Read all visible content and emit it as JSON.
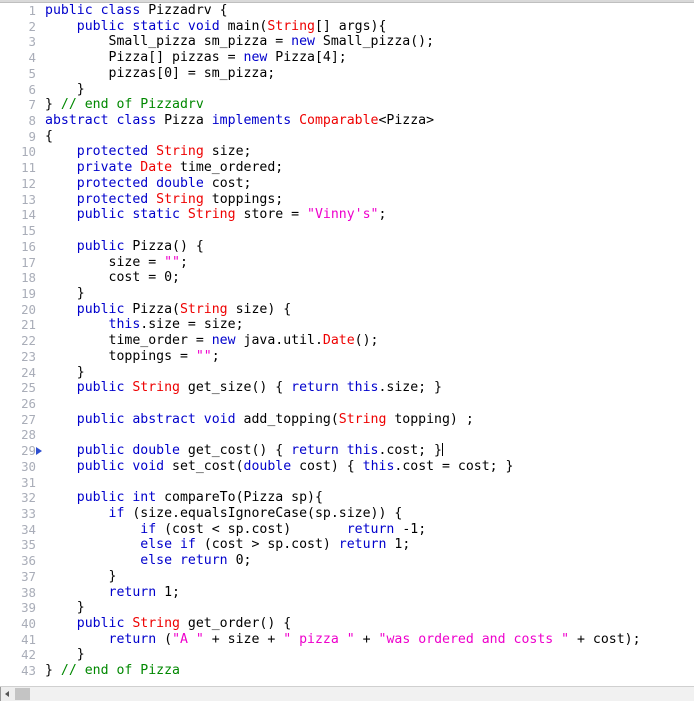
{
  "editor": {
    "language": "java",
    "colors": {
      "keyword": "#0000cc",
      "type": "#ee0000",
      "string": "#ee00cc",
      "comment": "#008800",
      "plain": "#000000",
      "line_number": "#a9adb8",
      "background": "#ffffff",
      "scrollbar_thumb": "#c4c4c4"
    },
    "caret_line": 29,
    "marker_line": 29,
    "first_visible_line": 1,
    "last_visible_line": 43,
    "scrollbar": {
      "orientation": "horizontal",
      "left_arrow_glyph": "◂"
    },
    "lines": [
      {
        "n": "1",
        "tokens": [
          {
            "t": "kw",
            "s": "public class "
          },
          {
            "t": "pln",
            "s": "Pizzadrv {"
          }
        ]
      },
      {
        "n": "2",
        "tokens": [
          {
            "t": "pln",
            "s": "    "
          },
          {
            "t": "kw",
            "s": "public static void "
          },
          {
            "t": "pln",
            "s": "main("
          },
          {
            "t": "typ",
            "s": "String"
          },
          {
            "t": "pln",
            "s": "[] args){"
          }
        ]
      },
      {
        "n": "3",
        "tokens": [
          {
            "t": "pln",
            "s": "        Small_pizza sm_pizza = "
          },
          {
            "t": "kw",
            "s": "new "
          },
          {
            "t": "pln",
            "s": "Small_pizza();"
          }
        ]
      },
      {
        "n": "4",
        "tokens": [
          {
            "t": "pln",
            "s": "        Pizza[] pizzas = "
          },
          {
            "t": "kw",
            "s": "new "
          },
          {
            "t": "pln",
            "s": "Pizza[4];"
          }
        ]
      },
      {
        "n": "5",
        "tokens": [
          {
            "t": "pln",
            "s": "        pizzas[0] = sm_pizza;"
          }
        ]
      },
      {
        "n": "6",
        "tokens": [
          {
            "t": "pln",
            "s": "    }"
          }
        ]
      },
      {
        "n": "7",
        "tokens": [
          {
            "t": "pln",
            "s": "} "
          },
          {
            "t": "cmt",
            "s": "// end of Pizzadrv"
          }
        ]
      },
      {
        "n": "8",
        "tokens": [
          {
            "t": "kw",
            "s": "abstract class "
          },
          {
            "t": "pln",
            "s": "Pizza "
          },
          {
            "t": "kw",
            "s": "implements "
          },
          {
            "t": "typ",
            "s": "Comparable"
          },
          {
            "t": "pln",
            "s": "<Pizza>"
          }
        ]
      },
      {
        "n": "9",
        "tokens": [
          {
            "t": "pln",
            "s": "{"
          }
        ]
      },
      {
        "n": "10",
        "tokens": [
          {
            "t": "pln",
            "s": "    "
          },
          {
            "t": "kw",
            "s": "protected "
          },
          {
            "t": "typ",
            "s": "String "
          },
          {
            "t": "pln",
            "s": "size;"
          }
        ]
      },
      {
        "n": "11",
        "tokens": [
          {
            "t": "pln",
            "s": "    "
          },
          {
            "t": "kw",
            "s": "private "
          },
          {
            "t": "typ",
            "s": "Date "
          },
          {
            "t": "pln",
            "s": "time_ordered;"
          }
        ]
      },
      {
        "n": "12",
        "tokens": [
          {
            "t": "pln",
            "s": "    "
          },
          {
            "t": "kw",
            "s": "protected double "
          },
          {
            "t": "pln",
            "s": "cost;"
          }
        ]
      },
      {
        "n": "13",
        "tokens": [
          {
            "t": "pln",
            "s": "    "
          },
          {
            "t": "kw",
            "s": "protected "
          },
          {
            "t": "typ",
            "s": "String "
          },
          {
            "t": "pln",
            "s": "toppings;"
          }
        ]
      },
      {
        "n": "14",
        "tokens": [
          {
            "t": "pln",
            "s": "    "
          },
          {
            "t": "kw",
            "s": "public static "
          },
          {
            "t": "typ",
            "s": "String "
          },
          {
            "t": "pln",
            "s": "store = "
          },
          {
            "t": "str",
            "s": "\"Vinny's\""
          },
          {
            "t": "pln",
            "s": ";"
          }
        ]
      },
      {
        "n": "15",
        "tokens": []
      },
      {
        "n": "16",
        "tokens": [
          {
            "t": "pln",
            "s": "    "
          },
          {
            "t": "kw",
            "s": "public "
          },
          {
            "t": "pln",
            "s": "Pizza() {"
          }
        ]
      },
      {
        "n": "17",
        "tokens": [
          {
            "t": "pln",
            "s": "        size = "
          },
          {
            "t": "str",
            "s": "\"\""
          },
          {
            "t": "pln",
            "s": ";"
          }
        ]
      },
      {
        "n": "18",
        "tokens": [
          {
            "t": "pln",
            "s": "        cost = 0;"
          }
        ]
      },
      {
        "n": "19",
        "tokens": [
          {
            "t": "pln",
            "s": "    }"
          }
        ]
      },
      {
        "n": "20",
        "tokens": [
          {
            "t": "pln",
            "s": "    "
          },
          {
            "t": "kw",
            "s": "public "
          },
          {
            "t": "pln",
            "s": "Pizza("
          },
          {
            "t": "typ",
            "s": "String "
          },
          {
            "t": "pln",
            "s": "size) {"
          }
        ]
      },
      {
        "n": "21",
        "tokens": [
          {
            "t": "pln",
            "s": "        "
          },
          {
            "t": "kw",
            "s": "this"
          },
          {
            "t": "pln",
            "s": ".size = size;"
          }
        ]
      },
      {
        "n": "22",
        "tokens": [
          {
            "t": "pln",
            "s": "        time_order = "
          },
          {
            "t": "kw",
            "s": "new "
          },
          {
            "t": "pln",
            "s": "java.util."
          },
          {
            "t": "typ",
            "s": "Date"
          },
          {
            "t": "pln",
            "s": "();"
          }
        ]
      },
      {
        "n": "23",
        "tokens": [
          {
            "t": "pln",
            "s": "        toppings = "
          },
          {
            "t": "str",
            "s": "\"\""
          },
          {
            "t": "pln",
            "s": ";"
          }
        ]
      },
      {
        "n": "24",
        "tokens": [
          {
            "t": "pln",
            "s": "    }"
          }
        ]
      },
      {
        "n": "25",
        "tokens": [
          {
            "t": "pln",
            "s": "    "
          },
          {
            "t": "kw",
            "s": "public "
          },
          {
            "t": "typ",
            "s": "String "
          },
          {
            "t": "pln",
            "s": "get_size() { "
          },
          {
            "t": "kw",
            "s": "return this"
          },
          {
            "t": "pln",
            "s": ".size; }"
          }
        ]
      },
      {
        "n": "26",
        "tokens": []
      },
      {
        "n": "27",
        "tokens": [
          {
            "t": "pln",
            "s": "    "
          },
          {
            "t": "kw",
            "s": "public abstract void "
          },
          {
            "t": "pln",
            "s": "add_topping("
          },
          {
            "t": "typ",
            "s": "String "
          },
          {
            "t": "pln",
            "s": "topping) ;"
          }
        ]
      },
      {
        "n": "28",
        "tokens": []
      },
      {
        "n": "29",
        "tokens": [
          {
            "t": "pln",
            "s": "    "
          },
          {
            "t": "kw",
            "s": "public double "
          },
          {
            "t": "pln",
            "s": "get_cost() { "
          },
          {
            "t": "kw",
            "s": "return this"
          },
          {
            "t": "pln",
            "s": ".cost; }"
          }
        ],
        "caret": true,
        "marker": true
      },
      {
        "n": "30",
        "tokens": [
          {
            "t": "pln",
            "s": "    "
          },
          {
            "t": "kw",
            "s": "public void "
          },
          {
            "t": "pln",
            "s": "set_cost("
          },
          {
            "t": "kw",
            "s": "double "
          },
          {
            "t": "pln",
            "s": "cost) { "
          },
          {
            "t": "kw",
            "s": "this"
          },
          {
            "t": "pln",
            "s": ".cost = cost; }"
          }
        ]
      },
      {
        "n": "31",
        "tokens": []
      },
      {
        "n": "32",
        "tokens": [
          {
            "t": "pln",
            "s": "    "
          },
          {
            "t": "kw",
            "s": "public int "
          },
          {
            "t": "pln",
            "s": "compareTo(Pizza sp){"
          }
        ]
      },
      {
        "n": "33",
        "tokens": [
          {
            "t": "pln",
            "s": "        "
          },
          {
            "t": "kw",
            "s": "if "
          },
          {
            "t": "pln",
            "s": "(size.equalsIgnoreCase(sp.size)) {"
          }
        ]
      },
      {
        "n": "34",
        "tokens": [
          {
            "t": "pln",
            "s": "            "
          },
          {
            "t": "kw",
            "s": "if "
          },
          {
            "t": "pln",
            "s": "(cost < sp.cost)       "
          },
          {
            "t": "kw",
            "s": "return "
          },
          {
            "t": "pln",
            "s": "-1;"
          }
        ]
      },
      {
        "n": "35",
        "tokens": [
          {
            "t": "pln",
            "s": "            "
          },
          {
            "t": "kw",
            "s": "else if "
          },
          {
            "t": "pln",
            "s": "(cost > sp.cost) "
          },
          {
            "t": "kw",
            "s": "return "
          },
          {
            "t": "pln",
            "s": "1;"
          }
        ]
      },
      {
        "n": "36",
        "tokens": [
          {
            "t": "pln",
            "s": "            "
          },
          {
            "t": "kw",
            "s": "else return "
          },
          {
            "t": "pln",
            "s": "0;"
          }
        ]
      },
      {
        "n": "37",
        "tokens": [
          {
            "t": "pln",
            "s": "        }"
          }
        ]
      },
      {
        "n": "38",
        "tokens": [
          {
            "t": "pln",
            "s": "        "
          },
          {
            "t": "kw",
            "s": "return "
          },
          {
            "t": "pln",
            "s": "1;"
          }
        ]
      },
      {
        "n": "39",
        "tokens": [
          {
            "t": "pln",
            "s": "    }"
          }
        ]
      },
      {
        "n": "40",
        "tokens": [
          {
            "t": "pln",
            "s": "    "
          },
          {
            "t": "kw",
            "s": "public "
          },
          {
            "t": "typ",
            "s": "String "
          },
          {
            "t": "pln",
            "s": "get_order() {"
          }
        ]
      },
      {
        "n": "41",
        "tokens": [
          {
            "t": "pln",
            "s": "        "
          },
          {
            "t": "kw",
            "s": "return "
          },
          {
            "t": "pln",
            "s": "("
          },
          {
            "t": "str",
            "s": "\"A \""
          },
          {
            "t": "pln",
            "s": " + size + "
          },
          {
            "t": "str",
            "s": "\" pizza \""
          },
          {
            "t": "pln",
            "s": " + "
          },
          {
            "t": "str",
            "s": "\"was ordered and costs \""
          },
          {
            "t": "pln",
            "s": " + cost);"
          }
        ]
      },
      {
        "n": "42",
        "tokens": [
          {
            "t": "pln",
            "s": "    }"
          }
        ]
      },
      {
        "n": "43",
        "tokens": [
          {
            "t": "pln",
            "s": "} "
          },
          {
            "t": "cmt",
            "s": "// end of Pizza"
          }
        ]
      }
    ]
  }
}
